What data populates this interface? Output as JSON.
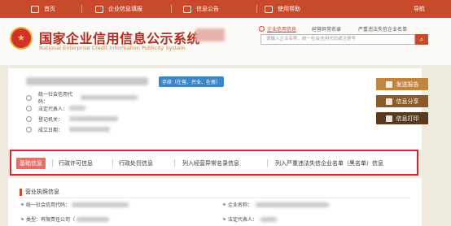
{
  "nav": {
    "items": [
      {
        "label": "首页",
        "icon": "home-icon"
      },
      {
        "label": "企业信息填报",
        "icon": "edit-icon"
      },
      {
        "label": "信息公告",
        "icon": "notice-icon"
      },
      {
        "label": "使用帮助",
        "icon": "help-icon"
      }
    ],
    "guide": "导航"
  },
  "header": {
    "title": "国家企业信用信息公示系统",
    "subtitle": "National Enterprise Credit Information Publicity System",
    "search_tabs": [
      "企业信用信息",
      "经营异常名录",
      "严重违法失信企业名单"
    ],
    "search_placeholder": "请输入企业名称、统一社会信用代码或注册号",
    "search_btn": "⌕"
  },
  "company": {
    "status": "存续（在营、开业、在册）",
    "fields": [
      {
        "label": "统一社会信用代码：",
        "icon": "id-icon"
      },
      {
        "label": "法定代表人：",
        "icon": "user-icon"
      },
      {
        "label": "登记机关：",
        "icon": "building-icon"
      },
      {
        "label": "成立日期：",
        "icon": "calendar-icon"
      }
    ],
    "actions": [
      {
        "label": "发送报告",
        "color": "#c0853f"
      },
      {
        "label": "信息分享",
        "color": "#8b5a2b"
      },
      {
        "label": "信息打印",
        "color": "#5a3a1f"
      }
    ]
  },
  "tabs": [
    "基础信息",
    "行政许可信息",
    "行政处罚信息",
    "列入经营异常名录信息",
    "列入严重违法失信企业名单（黑名单）信息"
  ],
  "business": {
    "title": "营业执照信息",
    "left": [
      "统一社会信用代码：",
      "类型：有限责任公司（"
    ],
    "right": [
      "企业名称：",
      "法定代表人："
    ]
  }
}
